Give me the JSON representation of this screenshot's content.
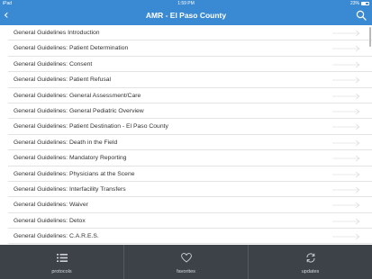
{
  "statusbar": {
    "carrier": "iPad",
    "time": "1:59 PM",
    "battery": "23%"
  },
  "navbar": {
    "back_icon": "chevron-left-icon",
    "title": "AMR - El Paso County",
    "search_icon": "search-icon"
  },
  "list": {
    "items": [
      {
        "label": "General Guidelines Introduction"
      },
      {
        "label": "General Guidelines: Patient Determination"
      },
      {
        "label": "General Guidelines: Consent"
      },
      {
        "label": "General Guidelines: Patient Refusal"
      },
      {
        "label": "General Guidelines: General Assessment/Care"
      },
      {
        "label": "General Guidelines: General Pediatric Overview"
      },
      {
        "label": "General Guidelines: Patient Destination - El Paso County"
      },
      {
        "label": "General Guidelines: Death in the Field"
      },
      {
        "label": "General Guidelines: Mandatory Reporting"
      },
      {
        "label": "General Guidelines: Physicians at the Scene"
      },
      {
        "label": "General Guidelines: Interfacility Transfers"
      },
      {
        "label": "General Guidelines: Waiver"
      },
      {
        "label": "General Guidelines: Detox"
      },
      {
        "label": "General Guidelines: C.A.R.E.S."
      }
    ]
  },
  "tabbar": {
    "tabs": [
      {
        "label": "protocols",
        "icon": "list-icon"
      },
      {
        "label": "favorites",
        "icon": "heart-icon"
      },
      {
        "label": "updates",
        "icon": "refresh-icon"
      }
    ]
  },
  "colors": {
    "brand_blue": "#3a8ad3",
    "tabbar_bg": "#3d4148"
  }
}
